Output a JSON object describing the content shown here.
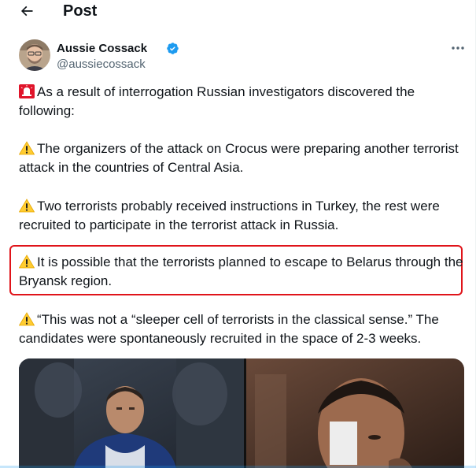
{
  "header": {
    "title": "Post"
  },
  "author": {
    "name": "Aussie Cossack",
    "handle": "@aussiecossack"
  },
  "tweet": {
    "paragraphs": [
      {
        "emoji": "siren-icon",
        "text": "As a result of interrogation Russian investigators discovered the following:"
      },
      {
        "emoji": "warning-icon",
        "text": "The organizers of the attack on Crocus were preparing another terrorist attack in the countries of Central Asia."
      },
      {
        "emoji": "warning-icon",
        "text": "Two terrorists probably received instructions in Turkey, the rest were recruited to participate in the terrorist attack in Russia."
      },
      {
        "emoji": "warning-icon",
        "text": "It is possible that the terrorists planned to escape to Belarus through the Bryansk region.",
        "highlighted": true
      },
      {
        "emoji": "warning-icon",
        "text": "“This was not a “sleeper cell of terrorists in the classical sense.” The candidates were spontaneously recruited in the space of 2-3 weeks."
      }
    ]
  },
  "colors": {
    "verified": "#1d9bf0",
    "highlight_border": "#e0141a",
    "secondary_text": "#536471"
  }
}
